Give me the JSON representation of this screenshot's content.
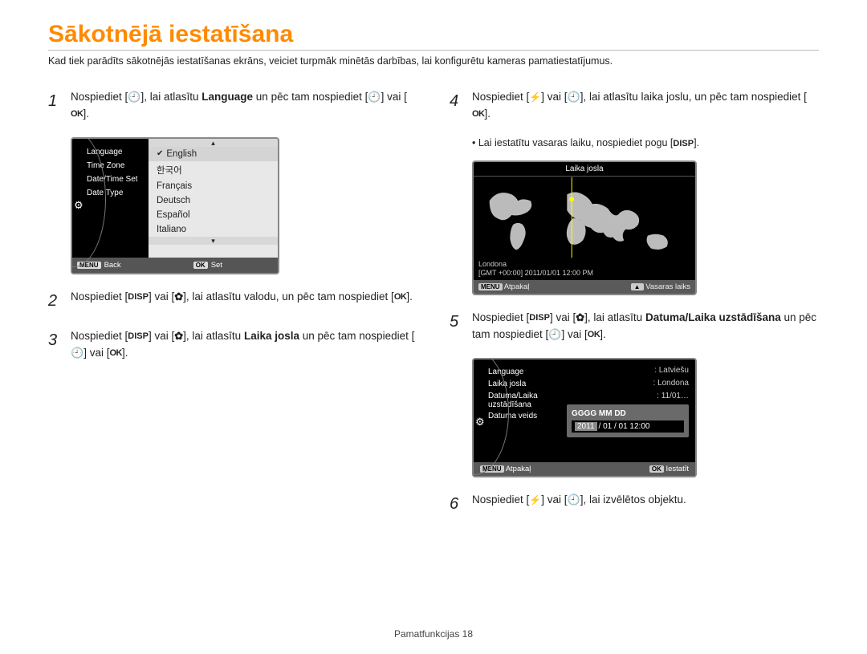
{
  "title": "Sākotnējā iestatīšana",
  "intro": "Kad tiek parādīts sākotnējās iestatīšanas ekrāns, veiciet turpmāk minētās darbības, lai konfigurētu kameras pamatiestatījumus.",
  "steps": {
    "s1a": "Nospiediet [",
    "s1b": "], lai atlasītu ",
    "s1c": "Language",
    "s1d": " un pēc tam nospiediet [",
    "s1e": "] vai [",
    "s1f": "].",
    "s2a": "Nospiediet [",
    "s2b": "] vai [",
    "s2c": "], lai atlasītu valodu, un pēc tam nospiediet [",
    "s2d": "].",
    "s3a": "Nospiediet [",
    "s3b": "] vai [",
    "s3c": "], lai atlasītu ",
    "s3d": "Laika josla",
    "s3e": " un pēc tam nospiediet [",
    "s3f": "] vai [",
    "s3g": "].",
    "s4a": "Nospiediet [",
    "s4b": "] vai [",
    "s4c": "], lai atlasītu laika joslu, un pēc tam nospiediet [",
    "s4d": "].",
    "s5a": "Nospiediet [",
    "s5b": "] vai [",
    "s5c": "], lai atlasītu ",
    "s5d": "Datuma/Laika uzstādīšana",
    "s5e": " un pēc tam nospiediet [",
    "s5f": "] vai [",
    "s5g": "].",
    "s6a": "Nospiediet [",
    "s6b": "] vai [",
    "s6c": "], lai izvēlētos objektu."
  },
  "note4": "Lai iestatītu vasaras laiku, nospiediet pogu [",
  "note4b": "].",
  "icons": {
    "ok": "OK",
    "disp": "DISP",
    "menu": "MENU"
  },
  "screen1": {
    "left": [
      "Language",
      "Time Zone",
      "Date/Time Set",
      "Date Type"
    ],
    "langs": [
      "English",
      "한국어",
      "Français",
      "Deutsch",
      "Español",
      "Italiano"
    ],
    "back": "Back",
    "set": "Set"
  },
  "screen2": {
    "title": "Laika josla",
    "city": "Londona",
    "gmt": "[GMT +00:00] 2011/01/01 12:00 PM",
    "back": "Atpakaļ",
    "dst": "Vasaras laiks"
  },
  "screen3": {
    "left": [
      "Language",
      "Laika josla",
      "Datuma/Laika uzstādīšana",
      "Datuma veids"
    ],
    "vals": [
      "Latviešu",
      "Londona",
      "11/01…"
    ],
    "fmt_hdr": "GGGG  MM  DD",
    "fmt_y": "2011",
    "fmt_rest": "/ 01 / 01 12:00",
    "back": "Atpakaļ",
    "set": "Iestatīt"
  },
  "footer": "Pamatfunkcijas  18"
}
